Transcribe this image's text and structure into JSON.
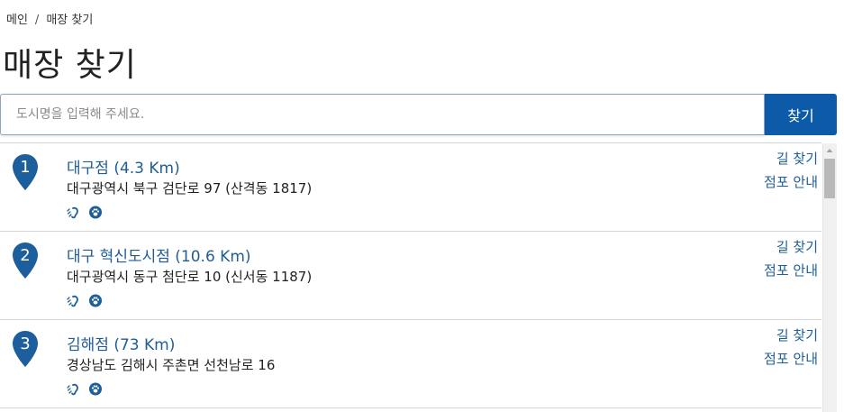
{
  "breadcrumb": {
    "home": "메인",
    "separator": "/",
    "current": "매장 찾기"
  },
  "page_title": "매장 찾기",
  "search": {
    "placeholder": "도시명을 입력해 주세요.",
    "value": "",
    "button_label": "찾기"
  },
  "stores": [
    {
      "number": "1",
      "name": "대구점 (4.3 Km)",
      "address": "대구광역시 북구 검단로 97 (산격동 1817)",
      "directions_label": "길 찾기",
      "info_label": "점포 안내",
      "amenities": [
        "hearing-assist-icon",
        "pet-friendly-icon"
      ]
    },
    {
      "number": "2",
      "name": "대구 혁신도시점 (10.6 Km)",
      "address": "대구광역시 동구 첨단로 10 (신서동 1187)",
      "directions_label": "길 찾기",
      "info_label": "점포 안내",
      "amenities": [
        "hearing-assist-icon",
        "pet-friendly-icon"
      ]
    },
    {
      "number": "3",
      "name": "김해점 (73 Km)",
      "address": "경상남도 김해시 주촌면 선천남로 16",
      "directions_label": "길 찾기",
      "info_label": "점포 안내",
      "amenities": [
        "hearing-assist-icon",
        "pet-friendly-icon"
      ]
    }
  ],
  "colors": {
    "brand_blue": "#0d5ba8",
    "link_blue": "#1f5d96",
    "pin_blue": "#1d5e9c"
  }
}
